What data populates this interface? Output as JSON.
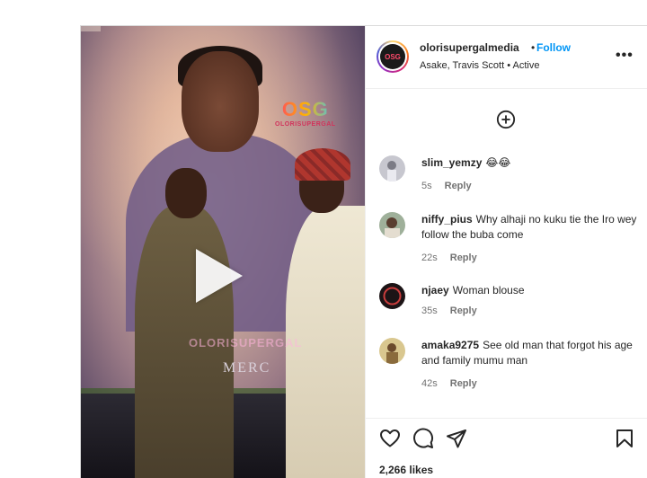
{
  "post": {
    "media": {
      "logo_text": "OSG",
      "logo_sub": "OLORISUPERGAL",
      "watermark": "OLORISUPERGAL",
      "backdrop_text": "MERC"
    },
    "header": {
      "username": "olorisupergalmedia",
      "separator": "•",
      "follow_label": "Follow",
      "audio": "Asake, Travis Scott • Active",
      "avatar_text": "OSG"
    },
    "comments": [
      {
        "username": "slim_yemzy",
        "text": "😂😂",
        "time": "5s",
        "reply": "Reply",
        "avatar_color": "#8f8f97"
      },
      {
        "username": "niffy_pius",
        "text": "Why alhaji no kuku tie the Iro wey follow the buba come",
        "time": "22s",
        "reply": "Reply",
        "avatar_color": "#6f8a6a"
      },
      {
        "username": "njaey",
        "text": "Woman blouse",
        "time": "35s",
        "reply": "Reply",
        "avatar_color": "#1c1416"
      },
      {
        "username": "amaka9275",
        "text": "See old man that forgot his age and family mumu man",
        "time": "42s",
        "reply": "Reply",
        "avatar_color": "#b49a5a"
      }
    ],
    "likes": "2,266 likes"
  },
  "icons": {
    "add": "plus-circle-icon",
    "like": "heart-icon",
    "comment": "comment-icon",
    "share": "send-icon",
    "save": "bookmark-icon",
    "more": "more-icon"
  }
}
